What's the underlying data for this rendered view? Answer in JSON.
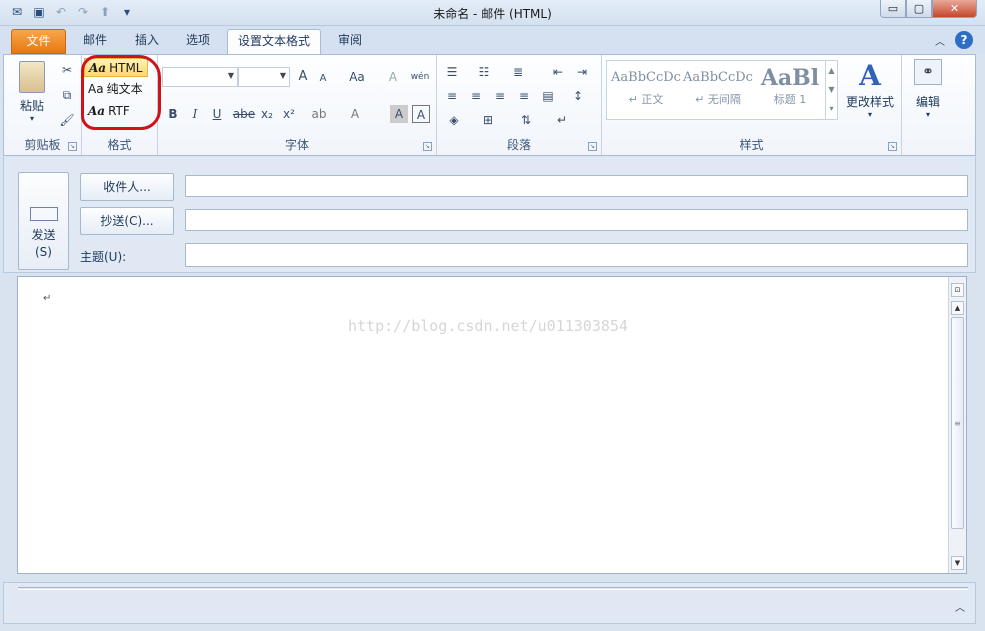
{
  "window": {
    "title": "未命名 - 邮件 (HTML)",
    "buttons": {
      "minimize": "▭",
      "restore": "▢",
      "close": "✕"
    }
  },
  "quick_access": {
    "icons": [
      "outlook-icon",
      "save-icon",
      "undo-icon",
      "redo-icon",
      "up-arrow-icon",
      "customize-dropdown-icon"
    ]
  },
  "tabs": [
    {
      "label": "文件"
    },
    {
      "label": "邮件"
    },
    {
      "label": "插入"
    },
    {
      "label": "选项"
    },
    {
      "label": "设置文本格式"
    },
    {
      "label": "审阅"
    }
  ],
  "ribbon": {
    "clipboard": {
      "paste_label": "粘贴",
      "group_label": "剪贴板"
    },
    "format": {
      "items": [
        {
          "icon_text": "Aa",
          "label": "HTML"
        },
        {
          "icon_text": "Aa",
          "label": "纯文本"
        },
        {
          "icon_text": "Aa",
          "label": "RTF"
        }
      ],
      "group_label": "格式"
    },
    "font": {
      "group_label": "字体",
      "buttons": {
        "grow": "A",
        "shrink": "A",
        "change_case": "Aa",
        "bold": "B",
        "italic": "I",
        "underline": "U",
        "strike": "abe",
        "subscript": "x₂",
        "superscript": "x²",
        "highlight": "ab",
        "font_color": "A",
        "char_shading": "A",
        "char_border": "A",
        "clear_format": "A",
        "phonetic": "wén"
      }
    },
    "paragraph": {
      "group_label": "段落"
    },
    "styles": {
      "group_label": "样式",
      "gallery": [
        {
          "sample": "AaBbCcDc",
          "name": "↵ 正文"
        },
        {
          "sample": "AaBbCcDc",
          "name": "↵ 无间隔"
        },
        {
          "sample": "AaBl",
          "name": "标题 1"
        }
      ],
      "change_styles": "更改样式"
    },
    "editing": {
      "label": "编辑"
    }
  },
  "header": {
    "send_label_1": "发送",
    "send_label_2": "(S)",
    "to_button": "收件人...",
    "cc_button": "抄送(C)...",
    "subject_label": "主题(U):",
    "to_value": "",
    "cc_value": "",
    "subject_value": ""
  },
  "body": {
    "paragraph_mark": "↵",
    "watermark": "http://blog.csdn.net/u011303854"
  },
  "colors": {
    "file_tab": "#e8780f",
    "annotation_circle": "#d0121b",
    "ribbon_bg": "#f1f5fb"
  }
}
